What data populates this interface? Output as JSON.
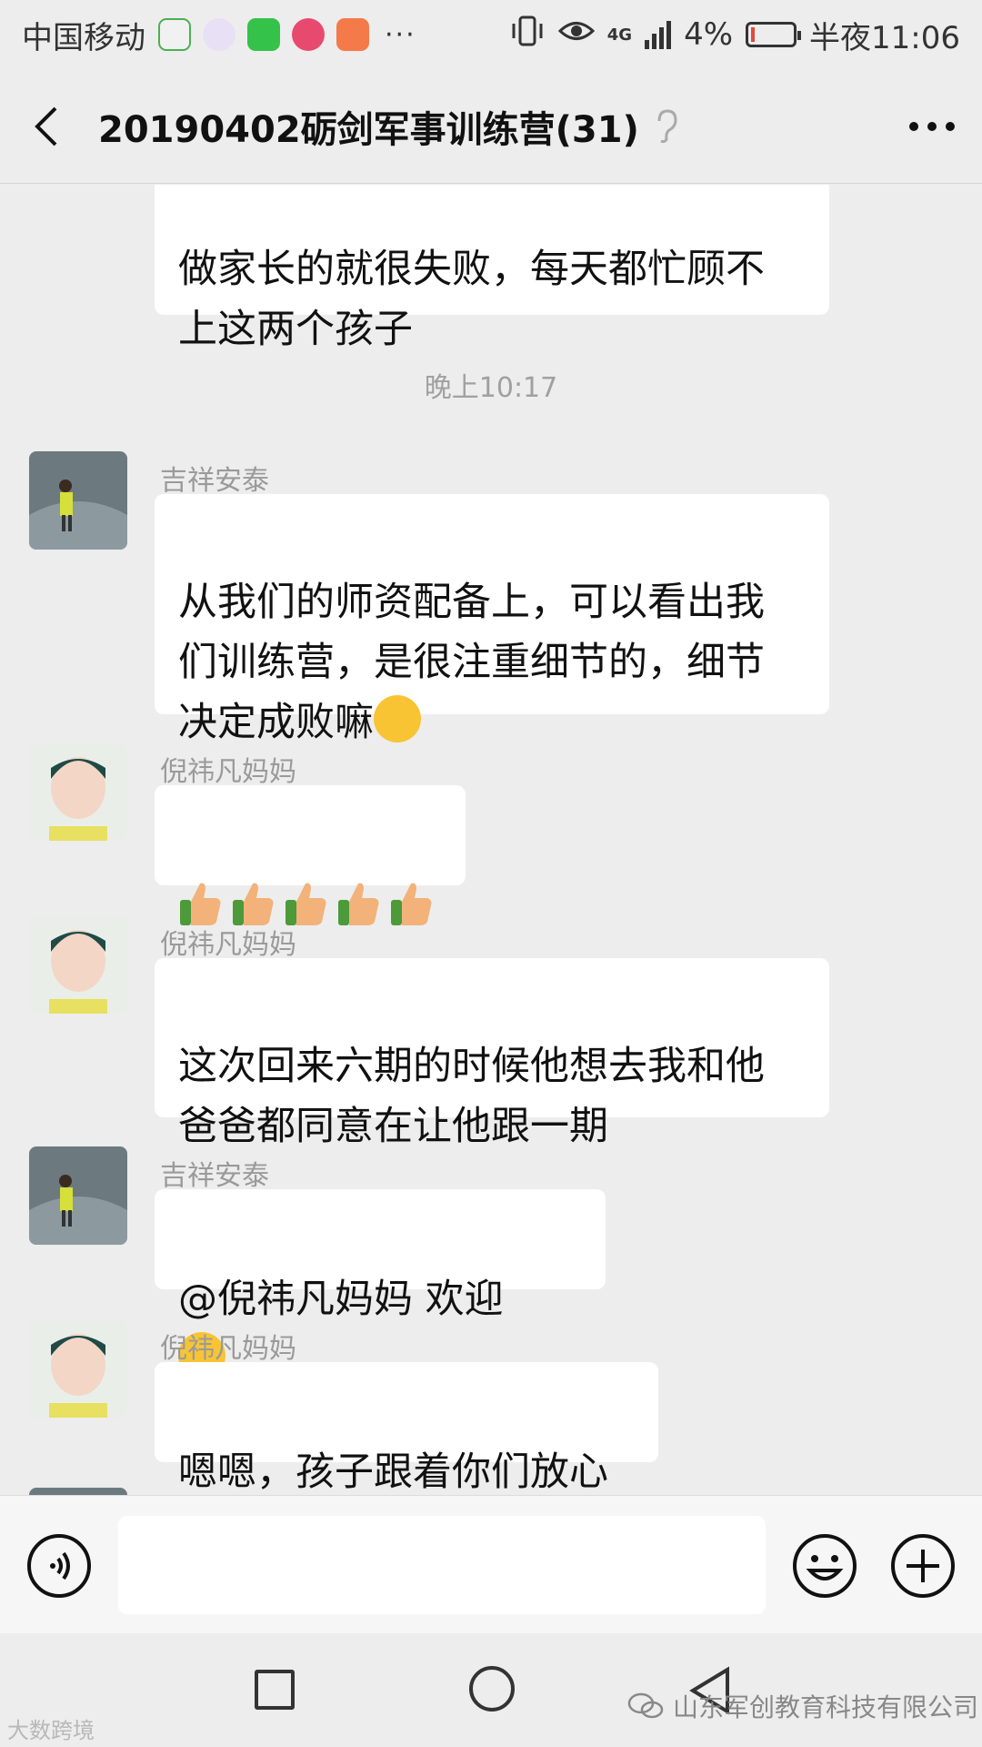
{
  "status_bar": {
    "carrier": "中国移动",
    "network": "4G",
    "battery": "4%",
    "time": "半夜11:06",
    "more": "···"
  },
  "header": {
    "title": "20190402砺剑军事训练营(31)"
  },
  "timestamp": "晚上10:17",
  "messages": [
    {
      "sender": "",
      "text": "做家长的就很失败，每天都忙顾不\n上这两个孩子"
    },
    {
      "sender": "吉祥安泰",
      "text": "从我们的师资配备上，可以看出我\n们训练营，是很注重细节的，细节\n决定成败嘛"
    },
    {
      "sender": "倪祎凡妈妈",
      "text": ""
    },
    {
      "sender": "倪祎凡妈妈",
      "text": "这次回来六期的时候他想去我和他\n爸爸都同意在让他跟一期"
    },
    {
      "sender": "吉祥安泰",
      "text": "@倪祎凡妈妈  欢迎"
    },
    {
      "sender": "倪祎凡妈妈",
      "text": "嗯嗯，孩子跟着你们放心"
    }
  ],
  "watermarks": {
    "left": "大数跨境",
    "right": "山东军创教育科技有限公司"
  },
  "colors": {
    "background": "#ededed",
    "bubble": "#ffffff",
    "emoji_yellow": "#f8c434"
  }
}
